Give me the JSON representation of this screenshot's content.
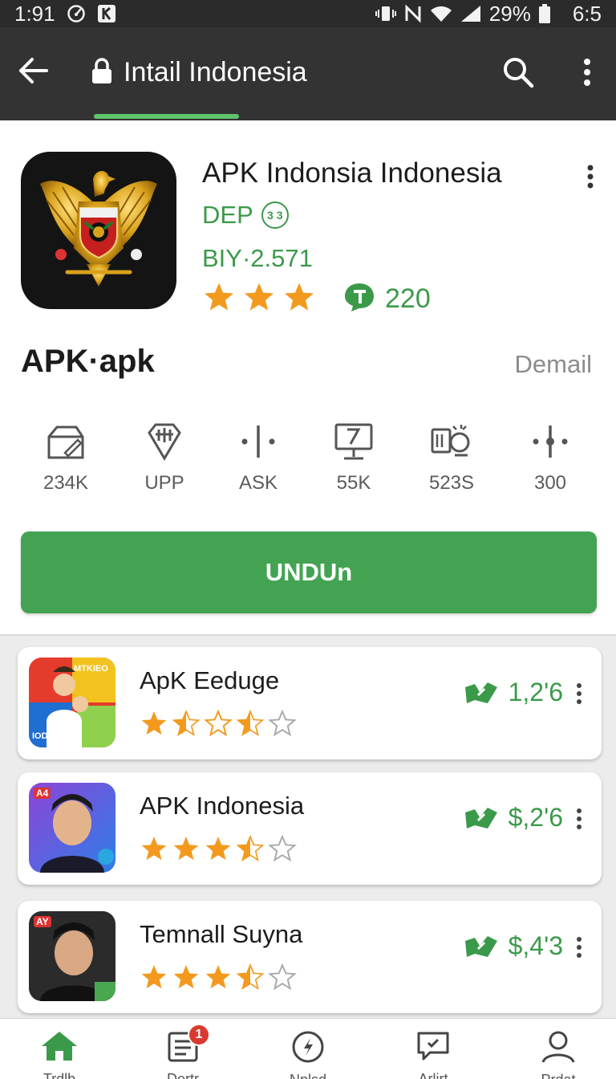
{
  "status_bar": {
    "time": "1:91",
    "battery": "29%",
    "clock_right": "6:5",
    "icons": [
      "speedometer-icon",
      "kindle-icon",
      "vibrate-icon",
      "nfc-icon",
      "wifi-icon",
      "signal-icon",
      "battery-icon"
    ]
  },
  "app_bar": {
    "title": "Intail Indonesia",
    "icons": [
      "back-arrow-icon",
      "lock-icon",
      "search-icon",
      "overflow-menu-icon"
    ]
  },
  "app": {
    "name": "APK Indonsia Indonesia",
    "developer": "DEP",
    "developer_badge": "3 3",
    "version": "BIY·2.571",
    "rating_stars": 3,
    "review_count": "220",
    "file_name": "APK·apk",
    "detail_link": "Demail",
    "colors": {
      "accent": "#43a352",
      "accent_text": "#3b9a4a",
      "star": "#f39a1e",
      "app_bar": "#333333"
    }
  },
  "stats": [
    {
      "icon": "box-pen-icon",
      "label": "234K"
    },
    {
      "icon": "shield-bars-icon",
      "label": "UPP"
    },
    {
      "icon": "divider-dots-icon",
      "label": "ASK"
    },
    {
      "icon": "monitor-icon",
      "label": "55K"
    },
    {
      "icon": "devices-icon",
      "label": "523S"
    },
    {
      "icon": "dots-line-icon",
      "label": "300"
    }
  ],
  "install_button": {
    "label": "UNDUn"
  },
  "list": [
    {
      "title": "ApK Eeduge",
      "rating": 2.5,
      "price": "1,2'6",
      "thumb_text": "MTKIEO",
      "thumb_text2": "IODHAA"
    },
    {
      "title": "APK Indonesia",
      "rating": 3.5,
      "price": "$,2'6",
      "thumb_text": "A4"
    },
    {
      "title": "Temnall Suyna",
      "rating": 3.5,
      "price": "$,4'3",
      "thumb_text": "AY"
    }
  ],
  "bottom_nav": {
    "items": [
      {
        "icon": "home-icon",
        "label": "Trdlb"
      },
      {
        "icon": "list-doc-icon",
        "label": "Dertr",
        "badge": "1"
      },
      {
        "icon": "compass-icon",
        "label": "Nplsd"
      },
      {
        "icon": "chat-icon",
        "label": "Arlirt"
      },
      {
        "icon": "profile-icon",
        "label": "Prdat"
      }
    ]
  }
}
